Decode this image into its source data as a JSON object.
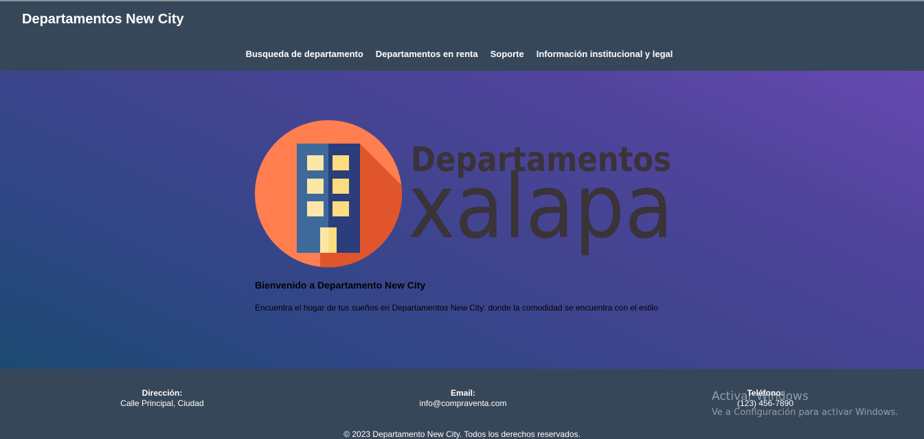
{
  "header": {
    "site_title": "Departamentos New City",
    "nav": [
      {
        "label": "Busqueda de departamento"
      },
      {
        "label": "Departamentos en renta"
      },
      {
        "label": "Soporte"
      },
      {
        "label": "Información institucional y legal"
      }
    ]
  },
  "hero": {
    "logo": {
      "line1": "Departamentos",
      "line2": "xalapa",
      "colors": {
        "circle": "#ff7f50",
        "circle_shadow": "#e0552b",
        "building_left": "#3d6a9a",
        "building_right": "#2b3d7b",
        "window_light": "#fde7a8",
        "window_dark": "#fbdd7f",
        "text": "#3a3338"
      }
    },
    "welcome_title": "Bienvenido a Departamento New City",
    "welcome_text": "Encuentra el hogar de tus sueños en Departamentos New City: donde la comodidad se encuentra con el estilo"
  },
  "footer": {
    "address_label": "Dirección:",
    "address_value": "Calle Principal, Ciudad",
    "email_label": "Email:",
    "email_value": "info@compraventa.com",
    "phone_label": "Teléfono:",
    "phone_value": "(123) 456-7890",
    "copyright": "© 2023 Departamento New City. Todos los derechos reservados."
  },
  "watermark": {
    "line1": "Activar Windows",
    "line2": "Ve a Configuración para activar Windows."
  },
  "colors": {
    "header_bg": "#37475a",
    "hero_gradient_start": "#1c4a72",
    "hero_gradient_end": "#6549b0"
  }
}
